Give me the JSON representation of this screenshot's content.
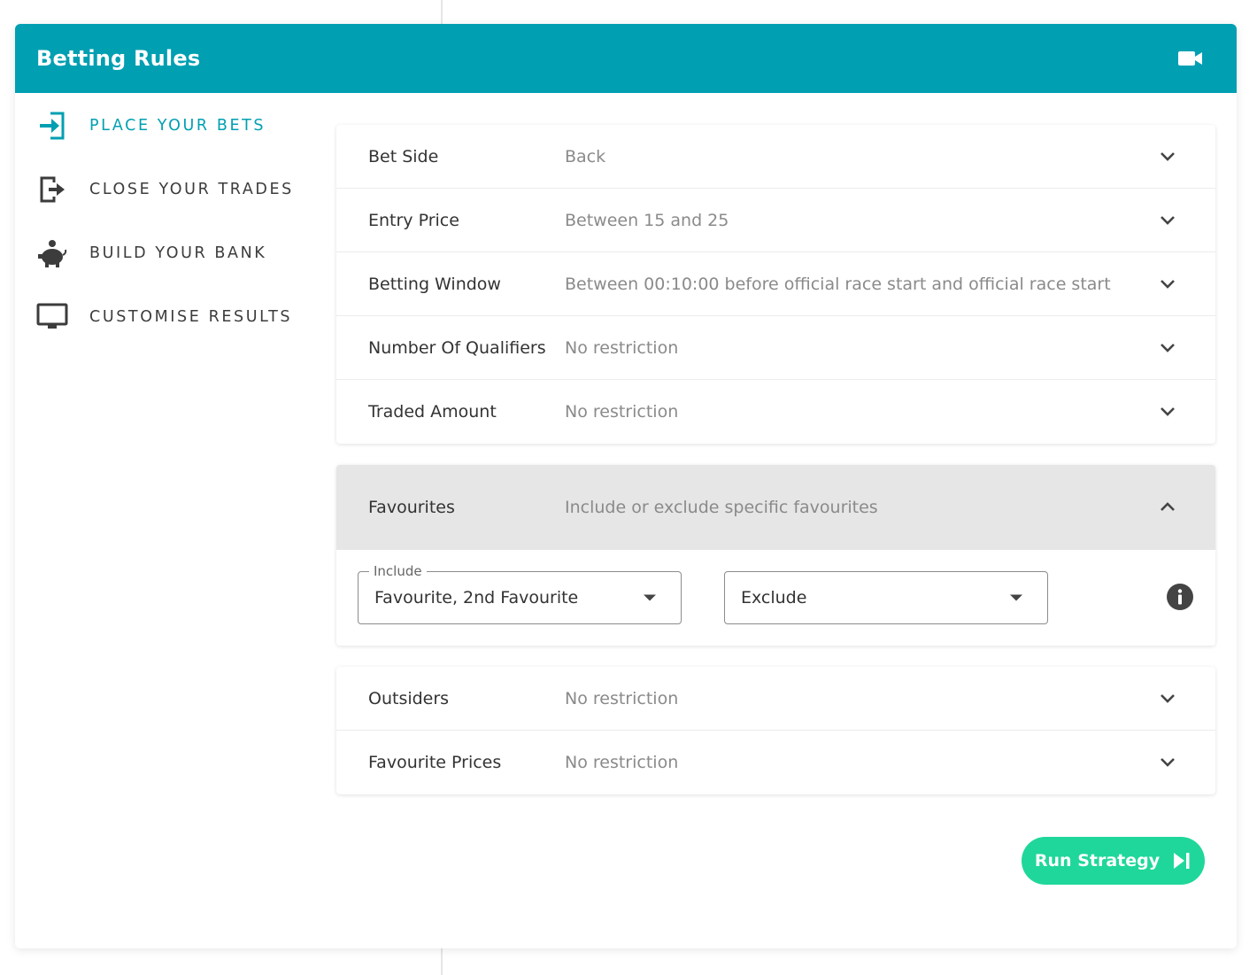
{
  "header": {
    "title": "Betting Rules",
    "video_icon": "video-camera-icon",
    "color": "#009fb2"
  },
  "sidebar": {
    "items": [
      {
        "label": "PLACE YOUR BETS",
        "icon": "sign-in-icon",
        "active": true
      },
      {
        "label": "CLOSE YOUR TRADES",
        "icon": "sign-out-icon",
        "active": false
      },
      {
        "label": "BUILD YOUR BANK",
        "icon": "piggy-bank-icon",
        "active": false
      },
      {
        "label": "CUSTOMISE RESULTS",
        "icon": "monitor-icon",
        "active": false
      }
    ]
  },
  "rules_group1": {
    "rows": [
      {
        "label": "Bet Side",
        "value": "Back"
      },
      {
        "label": "Entry Price",
        "value": "Between 15 and 25"
      },
      {
        "label": "Betting Window",
        "value": "Between 00:10:00 before official race start and official race start"
      },
      {
        "label": "Number Of Qualifiers",
        "value": "No restriction"
      },
      {
        "label": "Traded Amount",
        "value": "No restriction"
      }
    ]
  },
  "favourites": {
    "label": "Favourites",
    "value": "Include or exclude specific favourites",
    "include": {
      "legend": "Include",
      "value": "Favourite, 2nd Favourite"
    },
    "exclude": {
      "value": "Exclude"
    },
    "info_icon": "info-icon"
  },
  "rules_group3": {
    "rows": [
      {
        "label": "Outsiders",
        "value": "No restriction"
      },
      {
        "label": "Favourite Prices",
        "value": "No restriction"
      }
    ]
  },
  "run_button": {
    "label": "Run Strategy",
    "icon": "skip-forward-icon",
    "color": "#1fd79a"
  }
}
